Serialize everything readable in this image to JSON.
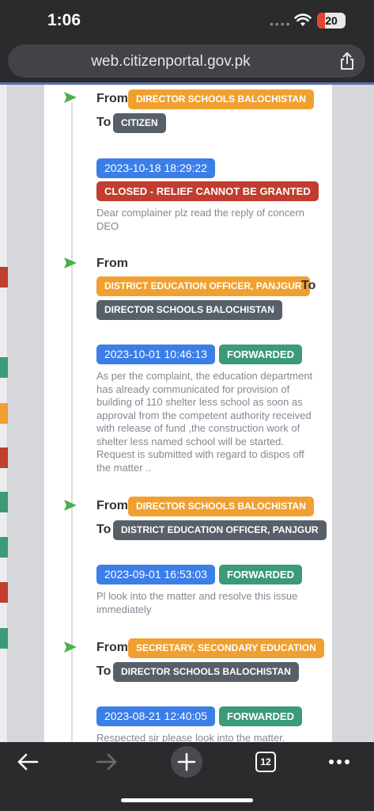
{
  "status_bar": {
    "time": "1:06",
    "battery": "20"
  },
  "browser": {
    "url": "web.citizenportal.gov.pk",
    "tab_count": "12"
  },
  "timeline": [
    {
      "from_label": "From",
      "from": "DIRECTOR SCHOOLS BALOCHISTAN",
      "to_label": "To",
      "to": "CITIZEN",
      "date": "2023-10-18 18:29:22",
      "status": "CLOSED - RELIEF CANNOT BE GRANTED",
      "message": "Dear complainer plz read the reply of concern DEO"
    },
    {
      "from_label": "From",
      "from": "DISTRICT EDUCATION OFFICER, PANJGUR",
      "to_label": "To",
      "to": "DIRECTOR SCHOOLS BALOCHISTAN",
      "date": "2023-10-01 10:46:13",
      "status": "FORWARDED",
      "message": "As per the complaint, the education department has already communicated for provision of building of 110 shelter less school as soon as approval from the competent authority received with release of fund ,the construction work of shelter less named school will be started.  Request is submitted with regard to dispos off the matter .."
    },
    {
      "from_label": "From",
      "from": "DIRECTOR SCHOOLS BALOCHISTAN",
      "to_label": "To",
      "to": "DISTRICT EDUCATION OFFICER, PANJGUR",
      "date": "2023-09-01 16:53:03",
      "status": "FORWARDED",
      "message": "Pl look into the matter and resolve this issue immediately"
    },
    {
      "from_label": "From",
      "from": "SECRETARY, SECONDARY EDUCATION",
      "to_label": "To",
      "to": "DIRECTOR SCHOOLS BALOCHISTAN",
      "date": "2023-08-21 12:40:05",
      "status": "FORWARDED",
      "message": "Respected sir please look into the matter."
    }
  ],
  "colors": {
    "from_badge": "#f0a030",
    "to_badge": "#575f68",
    "date_badge": "#3b7ee8",
    "forwarded": "#3c9a78",
    "closed": "#c03d2f",
    "arrow": "#4caf50"
  },
  "icons": {
    "arrow": "send-arrow-icon",
    "share": "share-icon",
    "back": "back-icon",
    "forward": "forward-icon",
    "new_tab": "plus-icon",
    "tabs": "tabs-icon",
    "menu": "more-icon"
  }
}
